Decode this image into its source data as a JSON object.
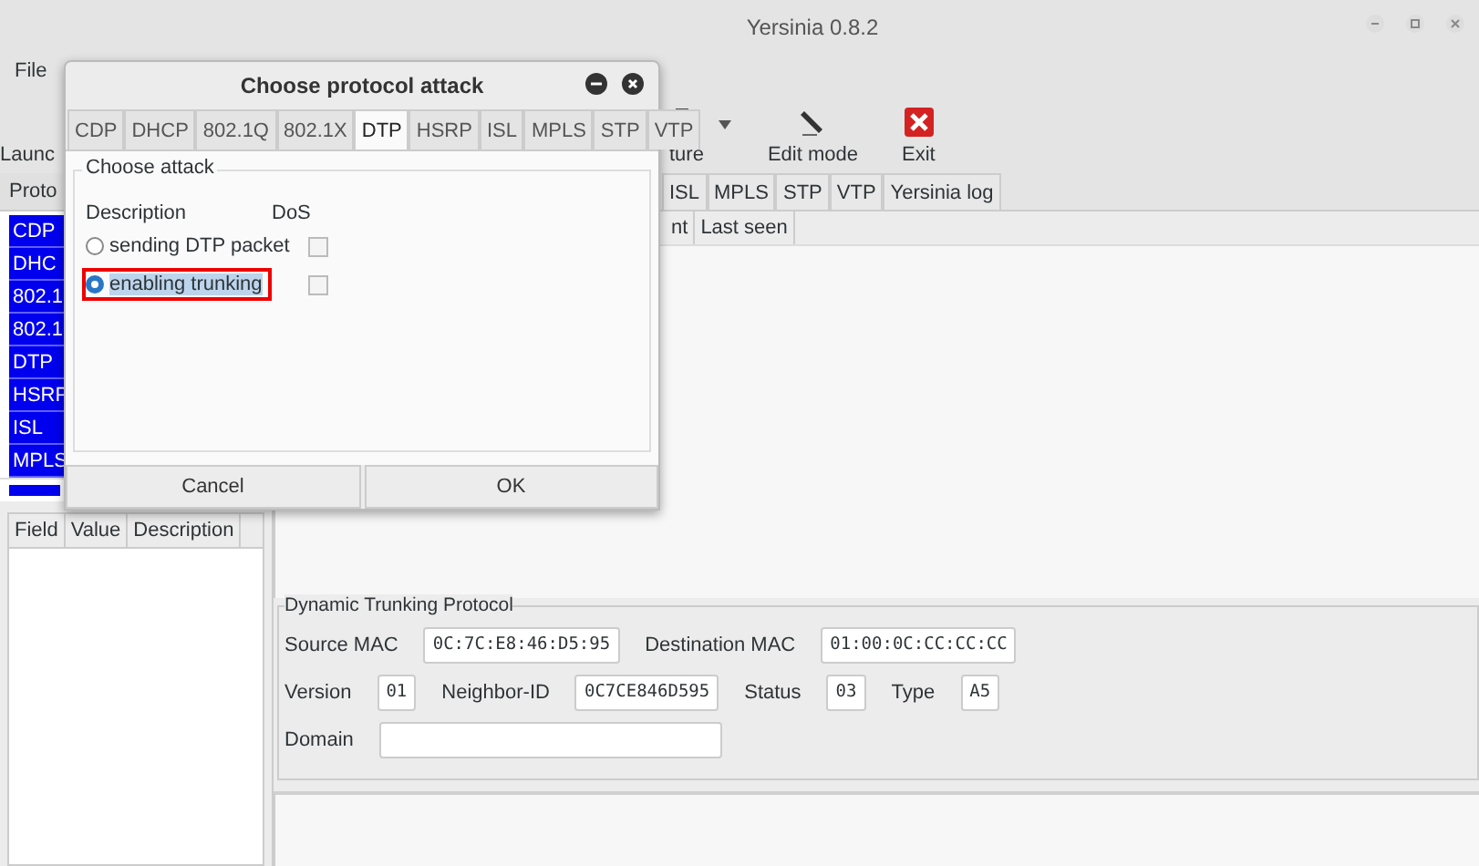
{
  "window": {
    "title": "Yersinia 0.8.2"
  },
  "menu": [
    "File"
  ],
  "toolbar": [
    {
      "label": "Launc",
      "kind": "plain"
    },
    {
      "label": "ture",
      "kind": "capture"
    },
    {
      "label": "Edit mode",
      "kind": "edit"
    },
    {
      "label": "Exit",
      "kind": "exit"
    }
  ],
  "protocol_list": {
    "header": "Proto",
    "items": [
      "CDP",
      "DHC",
      "802.1",
      "802.1",
      "DTP",
      "HSRP",
      "ISL",
      "MPLS"
    ]
  },
  "main_tabs": [
    {
      "label": "ISL",
      "selected": false
    },
    {
      "label": "MPLS",
      "selected": false
    },
    {
      "label": "STP",
      "selected": false
    },
    {
      "label": "VTP",
      "selected": false
    },
    {
      "label": "Yersinia log",
      "selected": false
    }
  ],
  "hosts_table": {
    "columns": [
      "nt",
      "Last seen"
    ]
  },
  "fields_table": {
    "columns": [
      "Field",
      "Value",
      "Description"
    ]
  },
  "dtp_frame": {
    "title": "Dynamic Trunking Protocol",
    "rows": [
      [
        {
          "label": "Source MAC",
          "value": "0C:7C:E8:46:D5:95"
        },
        {
          "label": "Destination MAC",
          "value": "01:00:0C:CC:CC:CC"
        }
      ],
      [
        {
          "label": "Version",
          "value": "01"
        },
        {
          "label": "Neighbor-ID",
          "value": "0C7CE846D595"
        },
        {
          "label": "Status",
          "value": "03"
        },
        {
          "label": "Type",
          "value": "A5"
        }
      ],
      [
        {
          "label": "Domain"
        }
      ]
    ]
  },
  "dialog": {
    "title": "Choose protocol attack",
    "tabs": [
      {
        "label": "CDP",
        "selected": false
      },
      {
        "label": "DHCP",
        "selected": false
      },
      {
        "label": "802.1Q",
        "selected": false
      },
      {
        "label": "802.1X",
        "selected": false
      },
      {
        "label": "DTP",
        "selected": true
      },
      {
        "label": "HSRP",
        "selected": false
      },
      {
        "label": "ISL",
        "selected": false
      },
      {
        "label": "MPLS",
        "selected": false
      },
      {
        "label": "STP",
        "selected": false
      },
      {
        "label": "VTP",
        "selected": false
      }
    ],
    "group_title": "Choose attack",
    "columns": [
      "Description",
      "DoS"
    ],
    "attacks": [
      {
        "label": "sending DTP packet",
        "selected": false,
        "dos": false,
        "marked": false
      },
      {
        "label": "enabling trunking",
        "selected": true,
        "dos": false,
        "marked": true
      }
    ],
    "buttons": [
      "Cancel",
      "OK"
    ]
  }
}
